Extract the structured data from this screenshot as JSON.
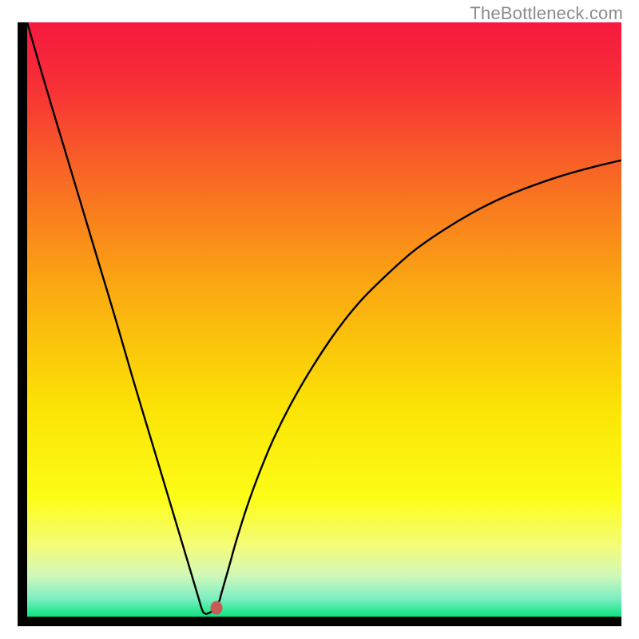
{
  "attribution": "TheBottleneck.com",
  "chart_data": {
    "type": "line",
    "title": "",
    "xlabel": "",
    "ylabel": "",
    "annotations": [],
    "x_range": [
      0,
      1
    ],
    "ylim": [
      0,
      100
    ],
    "background_gradient": {
      "stops": [
        {
          "pct": 0,
          "color": "#f6193e"
        },
        {
          "pct": 10,
          "color": "#f72e37"
        },
        {
          "pct": 25,
          "color": "#f86525"
        },
        {
          "pct": 45,
          "color": "#fbaa11"
        },
        {
          "pct": 65,
          "color": "#fbe405"
        },
        {
          "pct": 80,
          "color": "#fcfd17"
        },
        {
          "pct": 88,
          "color": "#f4fc78"
        },
        {
          "pct": 93,
          "color": "#d1f8b9"
        },
        {
          "pct": 97,
          "color": "#7ceec1"
        },
        {
          "pct": 100,
          "color": "#0be47f"
        }
      ]
    },
    "x": [
      0.0,
      0.029,
      0.059,
      0.089,
      0.119,
      0.149,
      0.178,
      0.208,
      0.238,
      0.268,
      0.287,
      0.295,
      0.3,
      0.303,
      0.312,
      0.323,
      0.326,
      0.33,
      0.34,
      0.352,
      0.37,
      0.39,
      0.415,
      0.445,
      0.48,
      0.52,
      0.56,
      0.605,
      0.65,
      0.7,
      0.75,
      0.8,
      0.85,
      0.9,
      0.95,
      1.0
    ],
    "values": [
      100.0,
      90.0,
      80.0,
      70.0,
      60.0,
      50.0,
      40.0,
      30.0,
      20.0,
      10.0,
      3.6,
      1.0,
      0.5,
      0.5,
      1.0,
      2.6,
      3.6,
      5.0,
      8.5,
      12.8,
      18.5,
      24.0,
      30.0,
      36.0,
      42.0,
      48.0,
      53.0,
      57.5,
      61.5,
      65.0,
      68.0,
      70.5,
      72.5,
      74.2,
      75.6,
      76.8
    ],
    "marker": {
      "x": 0.318,
      "y": 1.5,
      "color": "#c75a56"
    }
  }
}
